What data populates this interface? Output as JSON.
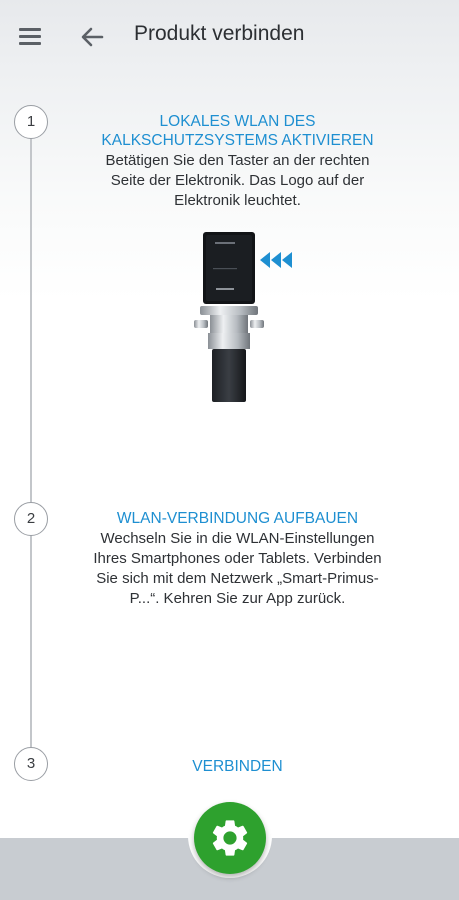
{
  "header": {
    "title": "Produkt verbinden",
    "menu_icon": "menu-icon",
    "back_icon": "arrow-left-icon"
  },
  "steps": [
    {
      "number": "1",
      "title_line1": "LOKALES WLAN DES",
      "title_line2": "KALKSCHUTZSYSTEMS AKTIVIEREN",
      "line1": "Betätigen Sie den Taster an der rechten",
      "line2": "Seite der Elektronik. Das Logo auf der",
      "line3": "Elektronik leuchtet."
    },
    {
      "number": "2",
      "title": "WLAN-VERBINDUNG AUFBAUEN",
      "line1": "Wechseln Sie in die WLAN-Einstellungen",
      "line2": "Ihres Smartphones oder Tablets. Verbinden",
      "line3": "Sie sich mit dem Netzwerk „Smart-Primus-",
      "line4": "P...“. Kehren Sie zur App zurück."
    },
    {
      "number": "3",
      "action_label": "VERBINDEN"
    }
  ],
  "fab": {
    "icon": "gear-icon"
  },
  "colors": {
    "accent": "#1e8fd1",
    "fab": "#2ea12e",
    "bottom_bar": "#c8ccd1",
    "text": "#2e3135"
  }
}
